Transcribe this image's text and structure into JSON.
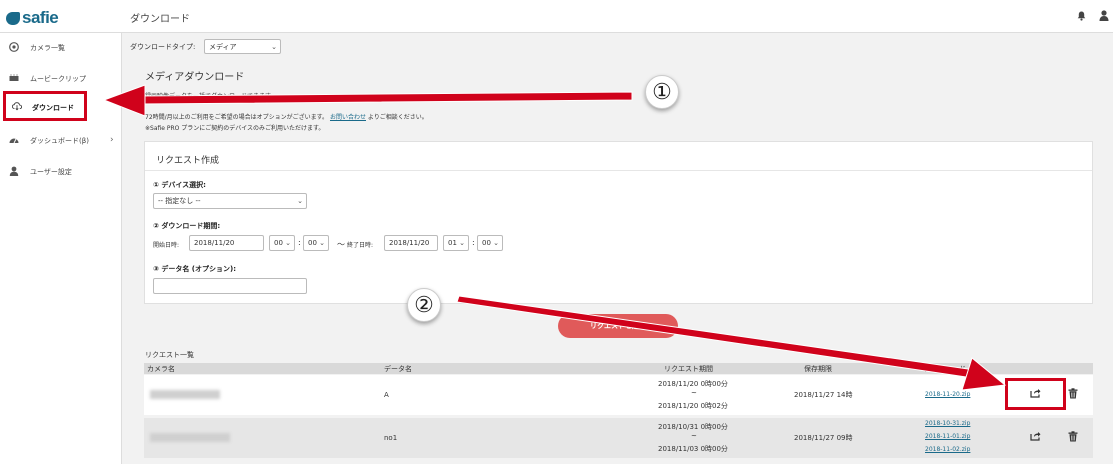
{
  "app": {
    "logo_text": "safie",
    "page_title": "ダウンロード"
  },
  "sidebar": {
    "items": [
      {
        "label": "カメラ一覧",
        "icon": "camera-icon"
      },
      {
        "label": "ムービークリップ",
        "icon": "film-icon"
      },
      {
        "label": "ダウンロード",
        "icon": "cloud-download-icon",
        "active": true
      },
      {
        "label": "ダッシュボード(β)",
        "icon": "dashboard-icon",
        "has_submenu": true
      },
      {
        "label": "ユーザー設定",
        "icon": "user-icon"
      }
    ]
  },
  "download_type": {
    "label": "ダウンロードタイプ:",
    "value": "メディア"
  },
  "section": {
    "title": "メディアダウンロード",
    "info_lines": [
      "録画映像データを一括でダウンロードできます。",
      "72時間/月以上のご利用をご希望の場合はオプションがございます。",
      "よりご相談ください。",
      "※Safie PRO プランにご契約のデバイスのみご利用いただけます。"
    ],
    "info_link": "お問い合わせ"
  },
  "request_form": {
    "title": "リクエスト作成",
    "device_label": "① デバイス選択:",
    "device_value": "-- 指定なし --",
    "period_label": "② ダウンロード期間:",
    "start_label": "開始日時:",
    "start_date": "2018/11/20",
    "start_hour": "00",
    "start_min": "00",
    "tilde": "〜",
    "end_label": "終了日時:",
    "end_date": "2018/11/20",
    "end_hour": "01",
    "end_min": "00",
    "colon": ":",
    "dataname_label": "③ データ名 (オプション):",
    "dataname_value": ""
  },
  "submit_label": "リクエストを送る",
  "request_list": {
    "title": "リクエスト一覧",
    "columns": [
      "カメラ名",
      "データ名",
      "リクエスト期間",
      "保存期限",
      "ダウンロード"
    ],
    "rows": [
      {
        "data_name": "A",
        "period_start": "2018/11/20 0時00分",
        "period_sep": "~",
        "period_end": "2018/11/20 0時02分",
        "expiry": "2018/11/27 14時",
        "files": [
          "2018-11-20.zip"
        ]
      },
      {
        "data_name": "no1",
        "period_start": "2018/10/31 0時00分",
        "period_sep": "~",
        "period_end": "2018/11/03 0時00分",
        "expiry": "2018/11/27 09時",
        "files": [
          "2018-10-31.zip",
          "2018-11-01.zip",
          "2018-11-02.zip"
        ]
      }
    ]
  },
  "annotations": {
    "badge_1": "①",
    "badge_2": "②"
  },
  "colors": {
    "brand": "#1a6a8a",
    "annotation_red": "#d0021b",
    "button": "#e05a5a"
  }
}
